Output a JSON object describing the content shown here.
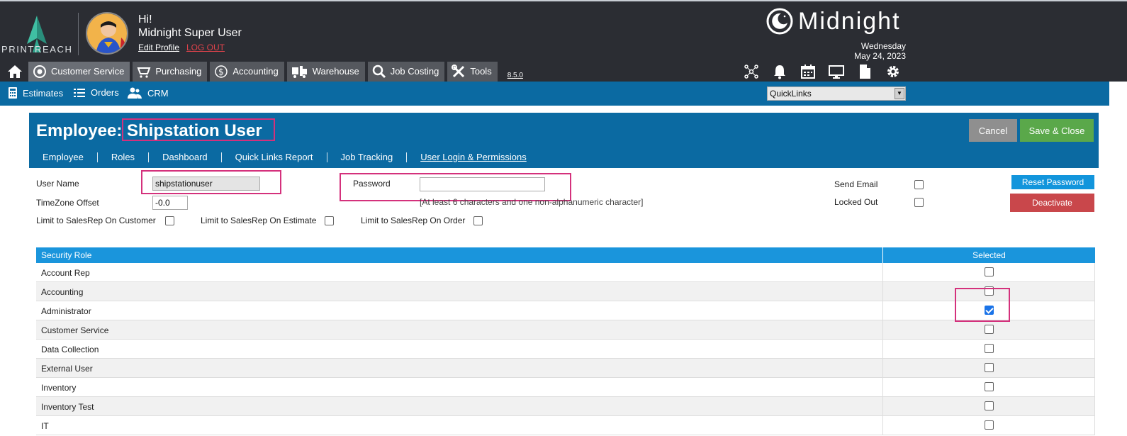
{
  "brand": {
    "logo_text": "PRINTREACH",
    "product": "Midnight"
  },
  "user": {
    "greeting": "Hi!",
    "name": "Midnight Super User",
    "edit_profile": "Edit Profile",
    "logout": "LOG OUT"
  },
  "date": {
    "weekday": "Wednesday",
    "full": "May 24, 2023"
  },
  "main_nav": [
    {
      "label": "Customer Service",
      "icon": "headset-icon"
    },
    {
      "label": "Purchasing",
      "icon": "cart-icon"
    },
    {
      "label": "Accounting",
      "icon": "dollar-icon"
    },
    {
      "label": "Warehouse",
      "icon": "forklift-icon"
    },
    {
      "label": "Job Costing",
      "icon": "magnifier-icon"
    },
    {
      "label": "Tools",
      "icon": "tools-icon"
    }
  ],
  "version": "8.5.0",
  "sub_nav": {
    "estimates": "Estimates",
    "orders": "Orders",
    "crm": "CRM",
    "quicklinks": "QuickLinks"
  },
  "panel": {
    "title_prefix": "Employee:",
    "employee_name": "Shipstation User",
    "cancel": "Cancel",
    "save_close": "Save & Close",
    "tabs": [
      "Employee",
      "Roles",
      "Dashboard",
      "Quick Links Report",
      "Job Tracking",
      "User Login & Permissions"
    ]
  },
  "form": {
    "user_name_label": "User Name",
    "user_name_value": "shipstationuser",
    "password_label": "Password",
    "password_value": "",
    "password_hint": "[At least 6 characters and one non-alphanumeric character]",
    "timezone_label": "TimeZone Offset",
    "timezone_value": "-0.0",
    "limit_customer": "Limit to SalesRep On Customer",
    "limit_estimate": "Limit to SalesRep On Estimate",
    "limit_order": "Limit to SalesRep On Order",
    "send_email": "Send Email",
    "locked_out": "Locked Out",
    "reset_password": "Reset Password",
    "deactivate": "Deactivate"
  },
  "roles_table": {
    "headers": [
      "Security Role",
      "Selected"
    ],
    "rows": [
      {
        "role": "Account Rep",
        "selected": false
      },
      {
        "role": "Accounting",
        "selected": false
      },
      {
        "role": "Administrator",
        "selected": true
      },
      {
        "role": "Customer Service",
        "selected": false
      },
      {
        "role": "Data Collection",
        "selected": false
      },
      {
        "role": "External User",
        "selected": false
      },
      {
        "role": "Inventory",
        "selected": false
      },
      {
        "role": "Inventory Test",
        "selected": false
      },
      {
        "role": "IT",
        "selected": false
      }
    ]
  },
  "colors": {
    "topbar": "#2b2d33",
    "primary_blue": "#0b6aa2",
    "header_blue": "#1a95dc",
    "save_green": "#5aa84a",
    "danger_red": "#c9474b",
    "highlight_pink": "#d4317c"
  }
}
